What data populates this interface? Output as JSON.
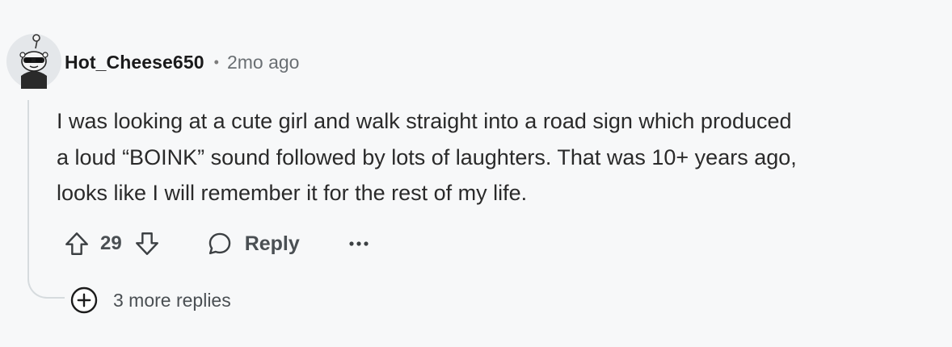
{
  "comment": {
    "username": "Hot_Cheese650",
    "separator": "•",
    "timestamp": "2mo ago",
    "body_lines": [
      "I was looking at a cute girl and walk straight into a road sign which produced",
      "a loud “BOINK” sound followed by lots of laughters. That was 10+ years ago,",
      "looks like I will remember it for the rest of my life."
    ],
    "actions": {
      "vote_count": "29",
      "reply_label": "Reply"
    },
    "more_replies_label": "3 more replies"
  },
  "icons": {
    "avatar": "snoo-avatar-with-sunglasses",
    "upvote": "arrow-up-icon",
    "downvote": "arrow-down-icon",
    "reply": "speech-bubble-icon",
    "overflow": "ellipsis-icon",
    "expand": "plus-circle-icon"
  },
  "colors": {
    "background": "#f7f8f9",
    "text_primary": "#1a1a1b",
    "text_secondary": "#4a4f53",
    "thread_line": "#d6dbde"
  }
}
